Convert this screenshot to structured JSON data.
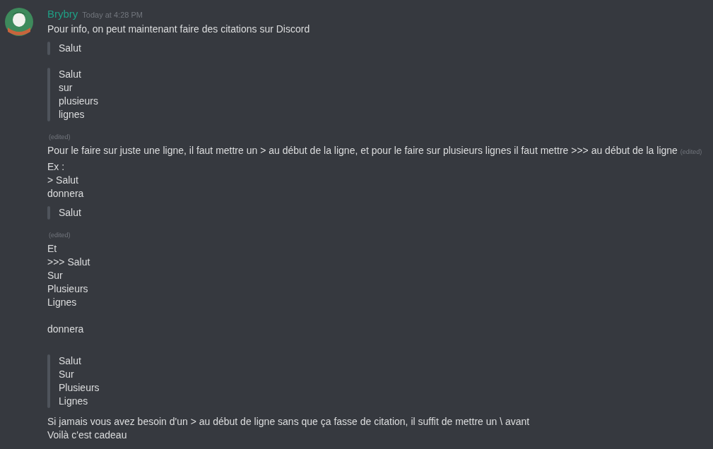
{
  "message": {
    "author": "Brybry",
    "timestamp": "Today at 4:28 PM",
    "blocks": [
      {
        "kind": "text",
        "lines": [
          "Pour info, on peut maintenant faire des citations sur Discord"
        ]
      },
      {
        "kind": "quote",
        "lines": [
          "Salut"
        ]
      },
      {
        "kind": "quote",
        "lines": [
          "Salut",
          "sur",
          "plusieurs",
          "lignes"
        ]
      },
      {
        "kind": "edited",
        "label": "(edited)"
      },
      {
        "kind": "text",
        "lines": [
          "Pour le faire sur juste une ligne, il faut mettre un > au début de la ligne, et pour le faire sur plusieurs lignes il faut mettre >>> au début de la ligne"
        ],
        "edited_label": "(edited)"
      },
      {
        "kind": "text",
        "lines": [
          "Ex :",
          "> Salut",
          "donnera"
        ]
      },
      {
        "kind": "quote",
        "lines": [
          "Salut"
        ]
      },
      {
        "kind": "edited",
        "label": "(edited)"
      },
      {
        "kind": "text",
        "lines": [
          "Et",
          ">>> Salut",
          "Sur",
          "Plusieurs",
          "Lignes"
        ]
      },
      {
        "kind": "text",
        "lines": [
          "donnera"
        ]
      },
      {
        "kind": "quote",
        "lines": [
          "Salut",
          "Sur",
          "Plusieurs",
          "Lignes"
        ]
      },
      {
        "kind": "text",
        "lines": [
          "Si jamais vous avez besoin d'un > au début de ligne sans que ça fasse de citation, il suffit de mettre un \\ avant",
          "Voilà c'est cadeau"
        ]
      }
    ]
  }
}
